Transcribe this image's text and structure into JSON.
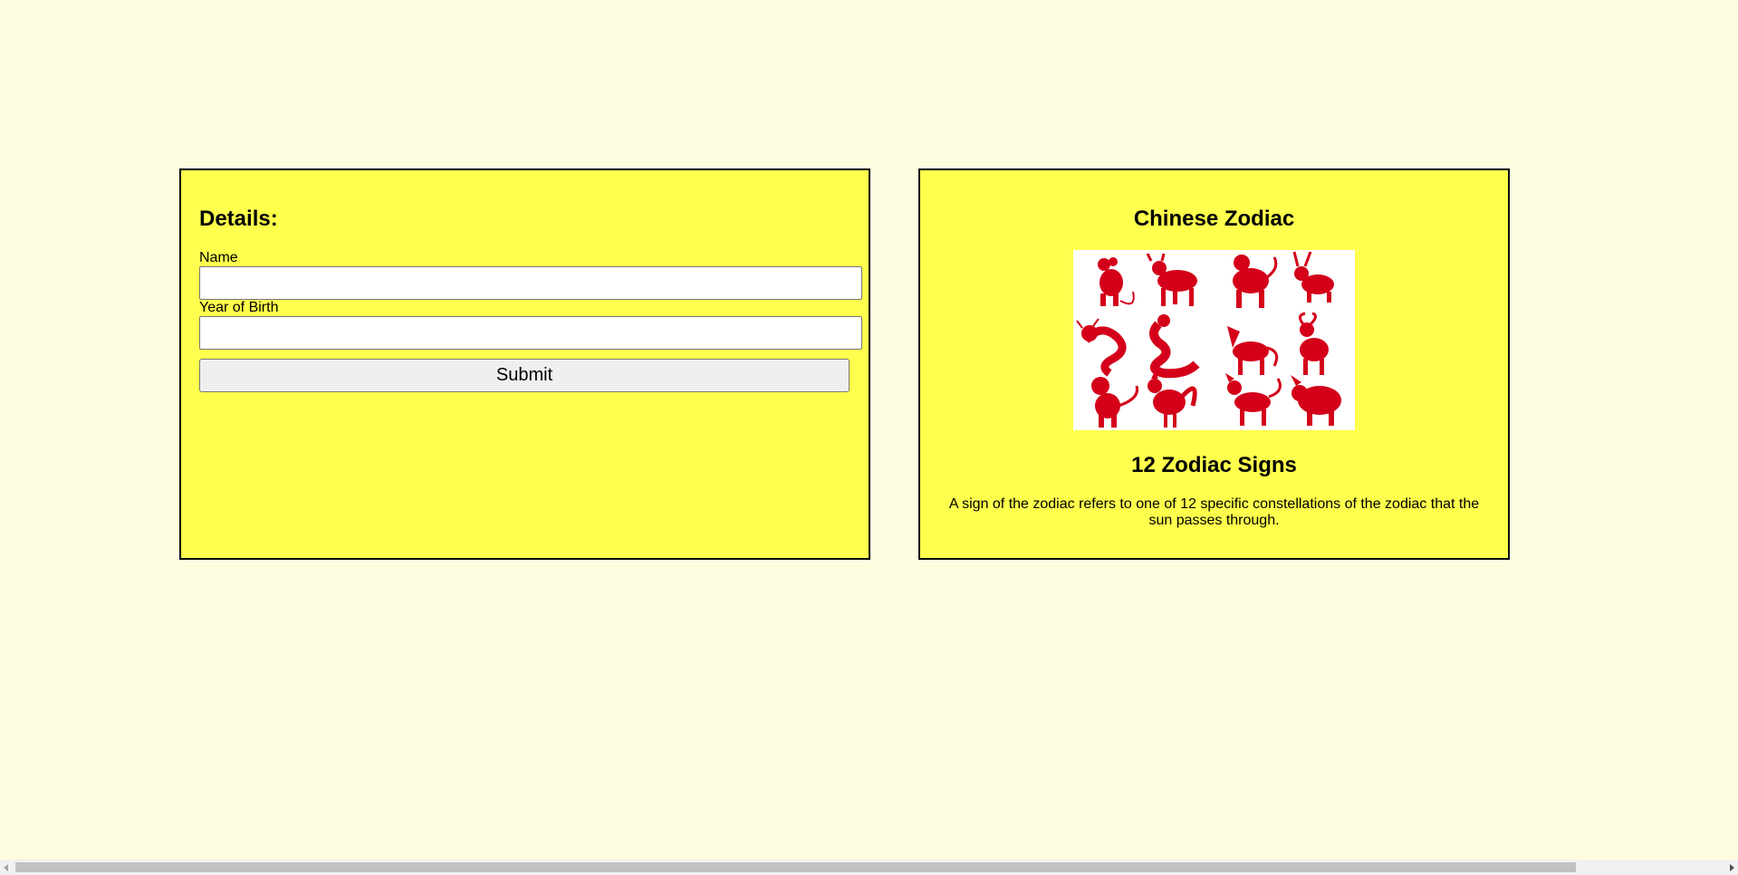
{
  "details": {
    "title": "Details:",
    "name_label": "Name",
    "name_value": "",
    "year_label": "Year of Birth",
    "year_value": "",
    "submit_label": "Submit"
  },
  "zodiac": {
    "title": "Chinese Zodiac",
    "image_subject": "twelve red papercut zodiac animals: rat, ox, tiger, rabbit, dragon, snake, horse, goat, monkey, rooster, dog, pig",
    "signs_title": "12 Zodiac Signs",
    "signs_description": "A sign of the zodiac refers to one of 12 specific constellations of the zodiac that the sun passes through."
  },
  "colors": {
    "page_background": "#fffde0",
    "panel_background": "#ffff4d",
    "zodiac_red": "#d4001a"
  }
}
